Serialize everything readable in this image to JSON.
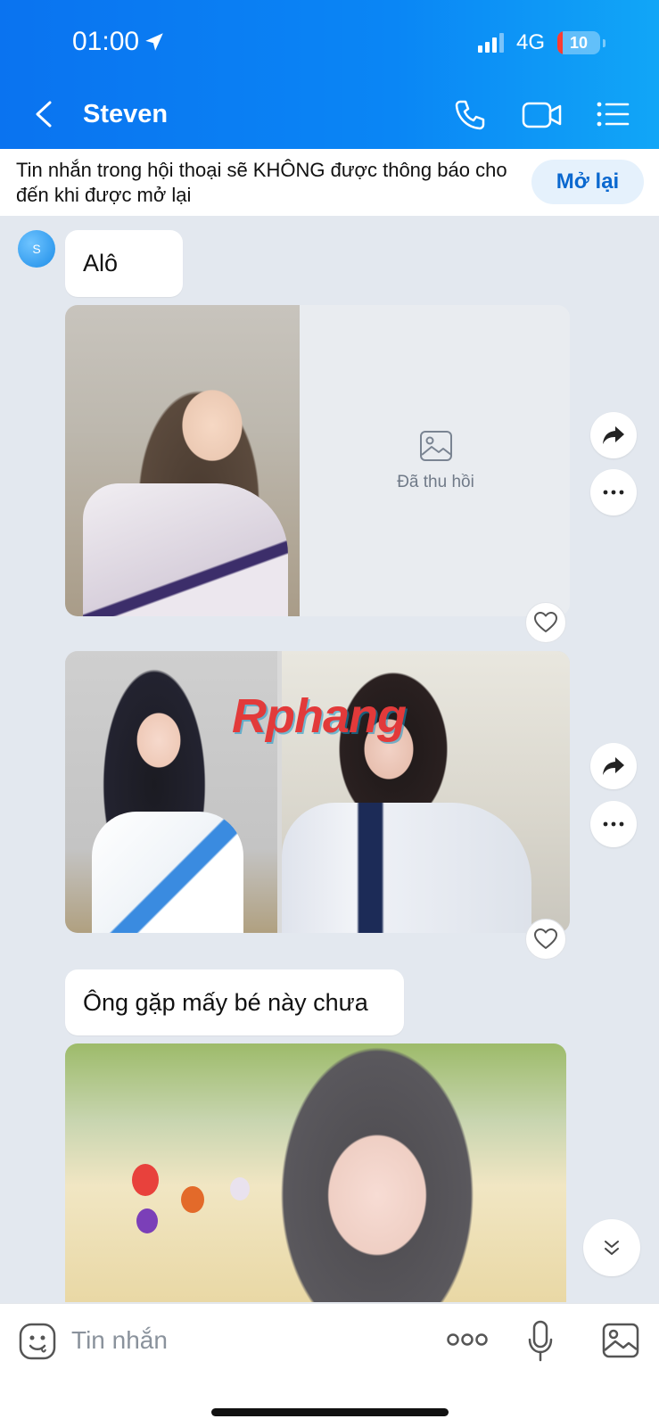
{
  "status_bar": {
    "time": "01:00",
    "network": "4G",
    "battery": "10"
  },
  "header": {
    "title": "Steven"
  },
  "banner": {
    "text": "Tin nhắn trong hội thoại sẽ KHÔNG được thông báo cho đến khi được mở lại",
    "button": "Mở lại"
  },
  "contact": {
    "avatar_initial": "S"
  },
  "messages": [
    {
      "type": "text",
      "text": "Alô"
    },
    {
      "type": "image_group",
      "recalled_label": "Đã thu hồi"
    },
    {
      "type": "image_group",
      "watermark": "Rphang"
    },
    {
      "type": "text",
      "text": "Ông gặp mấy bé này chưa"
    },
    {
      "type": "image"
    }
  ],
  "composer": {
    "placeholder": "Tin nhắn"
  },
  "colors": {
    "header_start": "#0a73f0",
    "header_end": "#11a6f7",
    "accent": "#0a68cf",
    "chat_background": "#e3e8ef"
  }
}
